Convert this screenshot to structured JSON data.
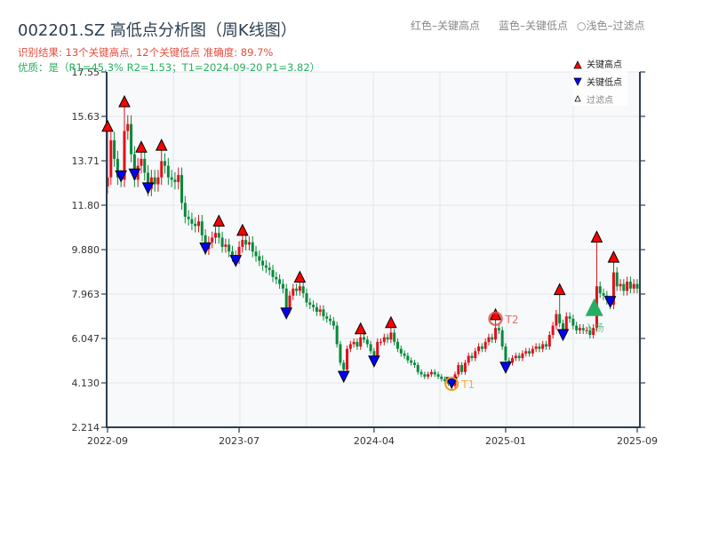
{
  "header": {
    "title": "002201.SZ 高低点分析图（周K线图）",
    "result_line": "识别结果: 13个关键高点, 12个关键低点   准确度: 89.7%",
    "quality_line": "优质：是（R1=45.3%  R2=1.53；T1=2024-09-20 P1=3.82）",
    "hint_red": "红色–关键高点",
    "hint_blue": "蓝色–关键低点",
    "hint_light": "○浅色–过滤点"
  },
  "colors": {
    "up": "#e0101a",
    "down": "#08893a",
    "high_marker": "#ff0000",
    "low_marker": "#0000ff",
    "entry": "#27ae60",
    "t1": "#f39c12",
    "t2": "#e74c3c",
    "axis": "#2c3e50",
    "grid": "#e3e6ea",
    "plot_bg": "#f7f9fb"
  },
  "chart_data": {
    "type": "candlestick",
    "title": "002201.SZ 高低点分析图（周K线图）",
    "ylim": [
      2.214,
      17.55
    ],
    "y_ticks": [
      "17.55",
      "15.63",
      "13.71",
      "11.80",
      "9.880",
      "7.963",
      "6.047",
      "4.130",
      "2.214"
    ],
    "x_ticks": [
      {
        "label": "2022-09",
        "i": 0
      },
      {
        "label": "2023-07",
        "i": 39
      },
      {
        "label": "2024-04",
        "i": 79
      },
      {
        "label": "2025-01",
        "i": 118
      },
      {
        "label": "2025-09",
        "i": 157
      }
    ],
    "close": [
      13.0,
      14.6,
      13.8,
      13.0,
      12.9,
      15.0,
      15.3,
      14.0,
      12.9,
      13.5,
      13.8,
      13.2,
      12.5,
      13.0,
      12.7,
      13.0,
      13.7,
      13.5,
      13.0,
      12.9,
      12.8,
      13.1,
      11.9,
      11.3,
      11.2,
      11.0,
      10.9,
      11.1,
      10.5,
      9.9,
      10.2,
      10.4,
      10.6,
      10.4,
      10.0,
      10.1,
      9.8,
      9.6,
      9.5,
      10.0,
      10.3,
      10.1,
      10.2,
      9.8,
      9.6,
      9.4,
      9.2,
      9.1,
      9.0,
      8.7,
      8.6,
      8.4,
      8.2,
      7.3,
      7.9,
      8.2,
      8.1,
      8.3,
      8.0,
      7.6,
      7.5,
      7.4,
      7.2,
      7.3,
      7.0,
      6.9,
      6.8,
      6.6,
      5.8,
      5.0,
      4.7,
      5.6,
      5.8,
      5.9,
      5.7,
      6.1,
      6.0,
      5.8,
      5.5,
      5.3,
      5.9,
      5.9,
      6.1,
      6.0,
      6.3,
      5.9,
      5.6,
      5.4,
      5.3,
      5.1,
      5.0,
      4.9,
      4.6,
      4.5,
      4.4,
      4.5,
      4.6,
      4.5,
      4.4,
      4.3,
      4.2,
      4.1,
      4.0,
      4.5,
      4.9,
      4.6,
      5.0,
      5.3,
      5.2,
      5.5,
      5.7,
      5.6,
      5.9,
      6.1,
      6.0,
      6.5,
      6.4,
      5.7,
      5.1,
      5.0,
      5.2,
      5.3,
      5.2,
      5.4,
      5.5,
      5.4,
      5.6,
      5.7,
      5.6,
      5.8,
      5.7,
      6.2,
      6.6,
      7.1,
      6.7,
      6.4,
      7.0,
      6.9,
      6.6,
      6.4,
      6.5,
      6.4,
      6.4,
      6.2,
      6.5,
      8.3,
      8.0,
      7.9,
      7.7,
      7.5,
      8.9,
      8.3,
      8.4,
      8.1,
      8.5,
      8.2,
      8.4,
      8.2
    ],
    "key_highs": [
      {
        "i": 0,
        "p": 14.99
      },
      {
        "i": 5,
        "p": 16.05
      },
      {
        "i": 10,
        "p": 14.09
      },
      {
        "i": 16,
        "p": 14.17
      },
      {
        "i": 33,
        "p": 10.9
      },
      {
        "i": 40,
        "p": 10.5
      },
      {
        "i": 57,
        "p": 8.48
      },
      {
        "i": 75,
        "p": 6.25
      },
      {
        "i": 84,
        "p": 6.52
      },
      {
        "i": 115,
        "p": 6.86
      },
      {
        "i": 134,
        "p": 7.94
      },
      {
        "i": 145,
        "p": 10.21
      },
      {
        "i": 150,
        "p": 9.34
      }
    ],
    "key_lows": [
      {
        "i": 4,
        "p": 12.82
      },
      {
        "i": 8,
        "p": 12.9
      },
      {
        "i": 12,
        "p": 12.3
      },
      {
        "i": 29,
        "p": 9.71
      },
      {
        "i": 38,
        "p": 9.17
      },
      {
        "i": 53,
        "p": 6.9
      },
      {
        "i": 70,
        "p": 4.17
      },
      {
        "i": 79,
        "p": 4.83
      },
      {
        "i": 102,
        "p": 3.9
      },
      {
        "i": 118,
        "p": 4.56
      },
      {
        "i": 135,
        "p": 5.97
      },
      {
        "i": 149,
        "p": 7.4
      }
    ],
    "t1": {
      "i": 102,
      "p": 3.9,
      "label": "T1"
    },
    "t2": {
      "i": 115,
      "p": 6.86,
      "label": "T2"
    },
    "entry": {
      "i": 144,
      "p": 7.4,
      "label": "入场"
    },
    "legend": {
      "position": "top-right",
      "items": [
        "关键高点",
        "关键低点",
        "过滤点"
      ]
    }
  }
}
